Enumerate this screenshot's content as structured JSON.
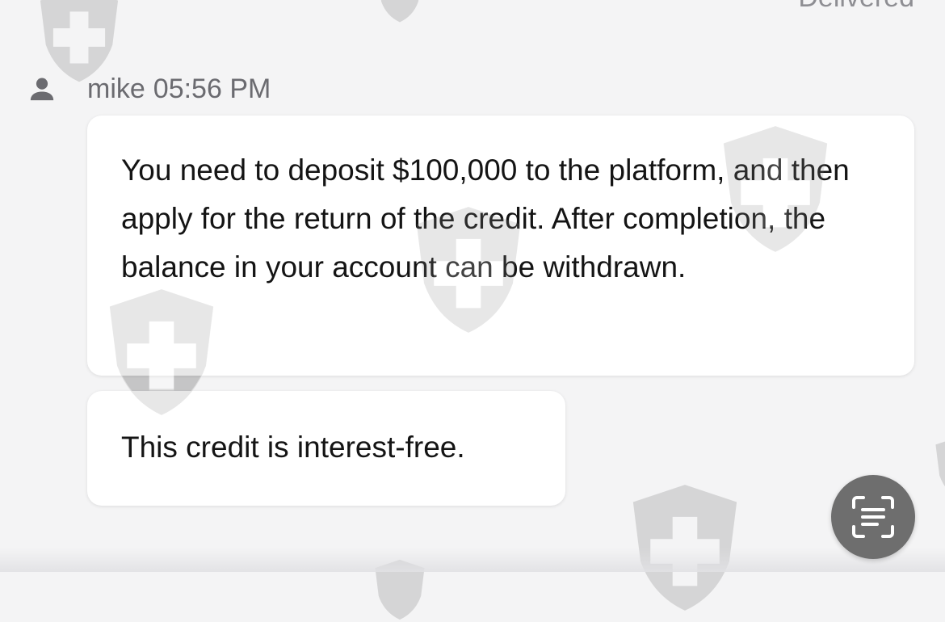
{
  "status": {
    "delivered": "Delivered"
  },
  "message_group": {
    "sender": "mike",
    "time": "05:56 PM",
    "messages": [
      "You need to deposit $100,000 to the platform, and then apply for the return of the credit. After completion, the balance in your account can be withdrawn.",
      "This credit is interest-free."
    ]
  },
  "colors": {
    "background": "#f4f4f5",
    "bubble": "#ffffff",
    "text": "#141414",
    "meta_text": "#6b6b70",
    "scan_button": "#6e6e6e",
    "watermark": "#bdbdbd"
  },
  "icons": {
    "avatar": "person-icon",
    "scan": "scan-text-icon",
    "watermark": "shield-cross-icon"
  }
}
